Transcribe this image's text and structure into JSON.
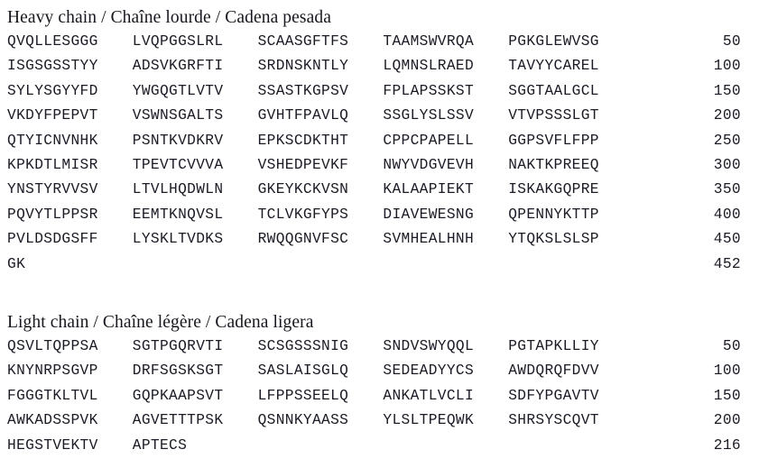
{
  "document": {
    "type": "protein-sequence-listing",
    "background_color": "#ffffff",
    "text_color": "#1b1b26"
  },
  "chains": [
    {
      "id": "heavy",
      "title": "Heavy chain / Chaîne lourde / Cadena pesada",
      "total_residues": "452",
      "rows": [
        {
          "groups": [
            "QVQLLESGGG",
            "LVQPGGSLRL",
            "SCAASGFTFS",
            "TAAMSWVRQA",
            "PGKGLEWVSG"
          ],
          "number": "50"
        },
        {
          "groups": [
            "ISGSGSSTYY",
            "ADSVKGRFTI",
            "SRDNSKNTLY",
            "LQMNSLRAED",
            "TAVYYCAREL"
          ],
          "number": "100"
        },
        {
          "groups": [
            "SYLYSGYYFD",
            "YWGQGTLVTV",
            "SSASTKGPSV",
            "FPLAPSSKST",
            "SGGTAALGCL"
          ],
          "number": "150"
        },
        {
          "groups": [
            "VKDYFPEPVT",
            "VSWNSGALTS",
            "GVHTFPAVLQ",
            "SSGLYSLSSV",
            "VTVPSSSLGT"
          ],
          "number": "200"
        },
        {
          "groups": [
            "QTYICNVNHK",
            "PSNTKVDKRV",
            "EPKSCDKTHT",
            "CPPCPAPELL",
            "GGPSVFLFPP"
          ],
          "number": "250"
        },
        {
          "groups": [
            "KPKDTLMISR",
            "TPEVTCVVVA",
            "VSHEDPEVKF",
            "NWYVDGVEVH",
            "NAKTKPREEQ"
          ],
          "number": "300"
        },
        {
          "groups": [
            "YNSTYRVVSV",
            "LTVLHQDWLN",
            "GKEYKCKVSN",
            "KALAAPIEKT",
            "ISKAKGQPRE"
          ],
          "number": "350"
        },
        {
          "groups": [
            "PQVYTLPPSR",
            "EEMTKNQVSL",
            "TCLVKGFYPS",
            "DIAVEWESNG",
            "QPENNYKTTP"
          ],
          "number": "400"
        },
        {
          "groups": [
            "PVLDSDGSFF",
            "LYSKLTVDKS",
            "RWQQGNVFSC",
            "SVMHEALHNH",
            "YTQKSLSLSP"
          ],
          "number": "450"
        },
        {
          "groups": [
            "GK",
            "",
            "",
            "",
            ""
          ],
          "number": "452"
        }
      ]
    },
    {
      "id": "light",
      "title": "Light chain / Chaîne légère / Cadena ligera",
      "total_residues": "216",
      "rows": [
        {
          "groups": [
            "QSVLTQPPSA",
            "SGTPGQRVTI",
            "SCSGSSSNIG",
            "SNDVSWYQQL",
            "PGTAPKLLIY"
          ],
          "number": "50"
        },
        {
          "groups": [
            "KNYNRPSGVP",
            "DRFSGSKSGT",
            "SASLAISGLQ",
            "SEDEADYYCS",
            "AWDQRQFDVV"
          ],
          "number": "100"
        },
        {
          "groups": [
            "FGGGTKLTVL",
            "GQPKAAPSVT",
            "LFPPSSEELQ",
            "ANKATLVCLI",
            "SDFYPGAVTV"
          ],
          "number": "150"
        },
        {
          "groups": [
            "AWKADSSPVK",
            "AGVETTTPSK",
            "QSNNKYAASS",
            "YLSLTPEQWK",
            "SHRSYSCQVT"
          ],
          "number": "200"
        },
        {
          "groups": [
            "HEGSTVEKTV",
            "APTECS",
            "",
            "",
            ""
          ],
          "number": "216"
        }
      ]
    }
  ]
}
